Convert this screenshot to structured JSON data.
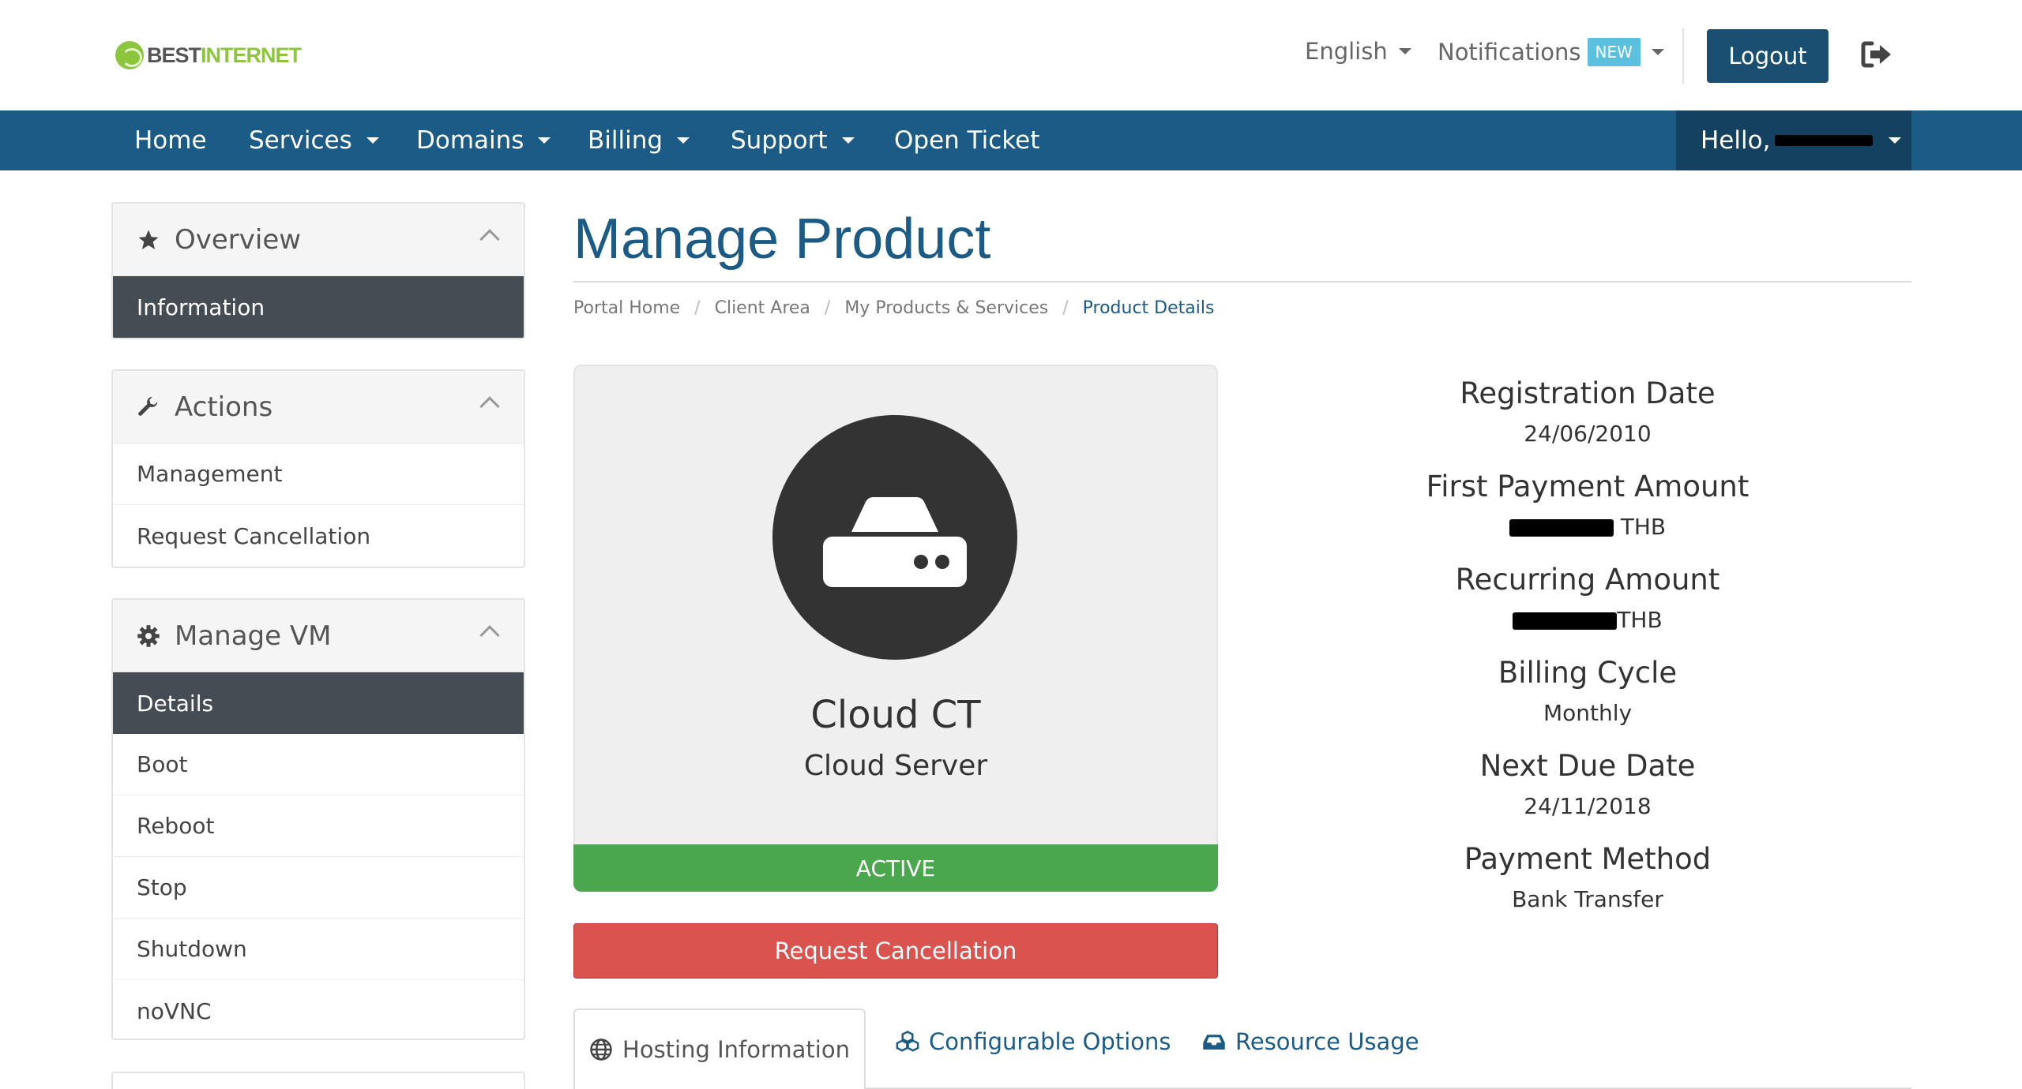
{
  "header": {
    "logo_best": "BEST",
    "logo_internet": "INTERNET",
    "language": "English",
    "notifications": "Notifications",
    "notifications_badge": "NEW",
    "logout": "Logout"
  },
  "nav": {
    "items": [
      {
        "label": "Home"
      },
      {
        "label": "Services"
      },
      {
        "label": "Domains"
      },
      {
        "label": "Billing"
      },
      {
        "label": "Support"
      },
      {
        "label": "Open Ticket"
      }
    ],
    "hello": "Hello,"
  },
  "sidebar": {
    "overview": {
      "title": "Overview",
      "items": [
        "Information"
      ]
    },
    "actions": {
      "title": "Actions",
      "items": [
        "Management",
        "Request Cancellation"
      ]
    },
    "manage_vm": {
      "title": "Manage VM",
      "items": [
        "Details",
        "Boot",
        "Reboot",
        "Stop",
        "Shutdown",
        "noVNC"
      ]
    }
  },
  "main": {
    "title": "Manage Product",
    "breadcrumb": [
      "Portal Home",
      "Client Area",
      "My Products & Services",
      "Product Details"
    ],
    "product": {
      "name": "Cloud CT",
      "group": "Cloud Server",
      "status": "ACTIVE"
    },
    "cancel_button": "Request Cancellation",
    "info": {
      "registration_date_label": "Registration Date",
      "registration_date": "24/06/2010",
      "first_payment_label": "First Payment Amount",
      "first_payment_currency": "THB",
      "recurring_label": "Recurring Amount",
      "recurring_currency": "THB",
      "billing_cycle_label": "Billing Cycle",
      "billing_cycle": "Monthly",
      "next_due_label": "Next Due Date",
      "next_due": "24/11/2018",
      "payment_method_label": "Payment Method",
      "payment_method": "Bank Transfer"
    },
    "tabs": [
      "Hosting Information",
      "Configurable Options",
      "Resource Usage"
    ]
  },
  "colors": {
    "nav": "#1b5b85",
    "active_sidebar": "#454d54",
    "status_active": "#4aa74d",
    "danger": "#d9534f",
    "logo_green": "#8cc63f"
  }
}
